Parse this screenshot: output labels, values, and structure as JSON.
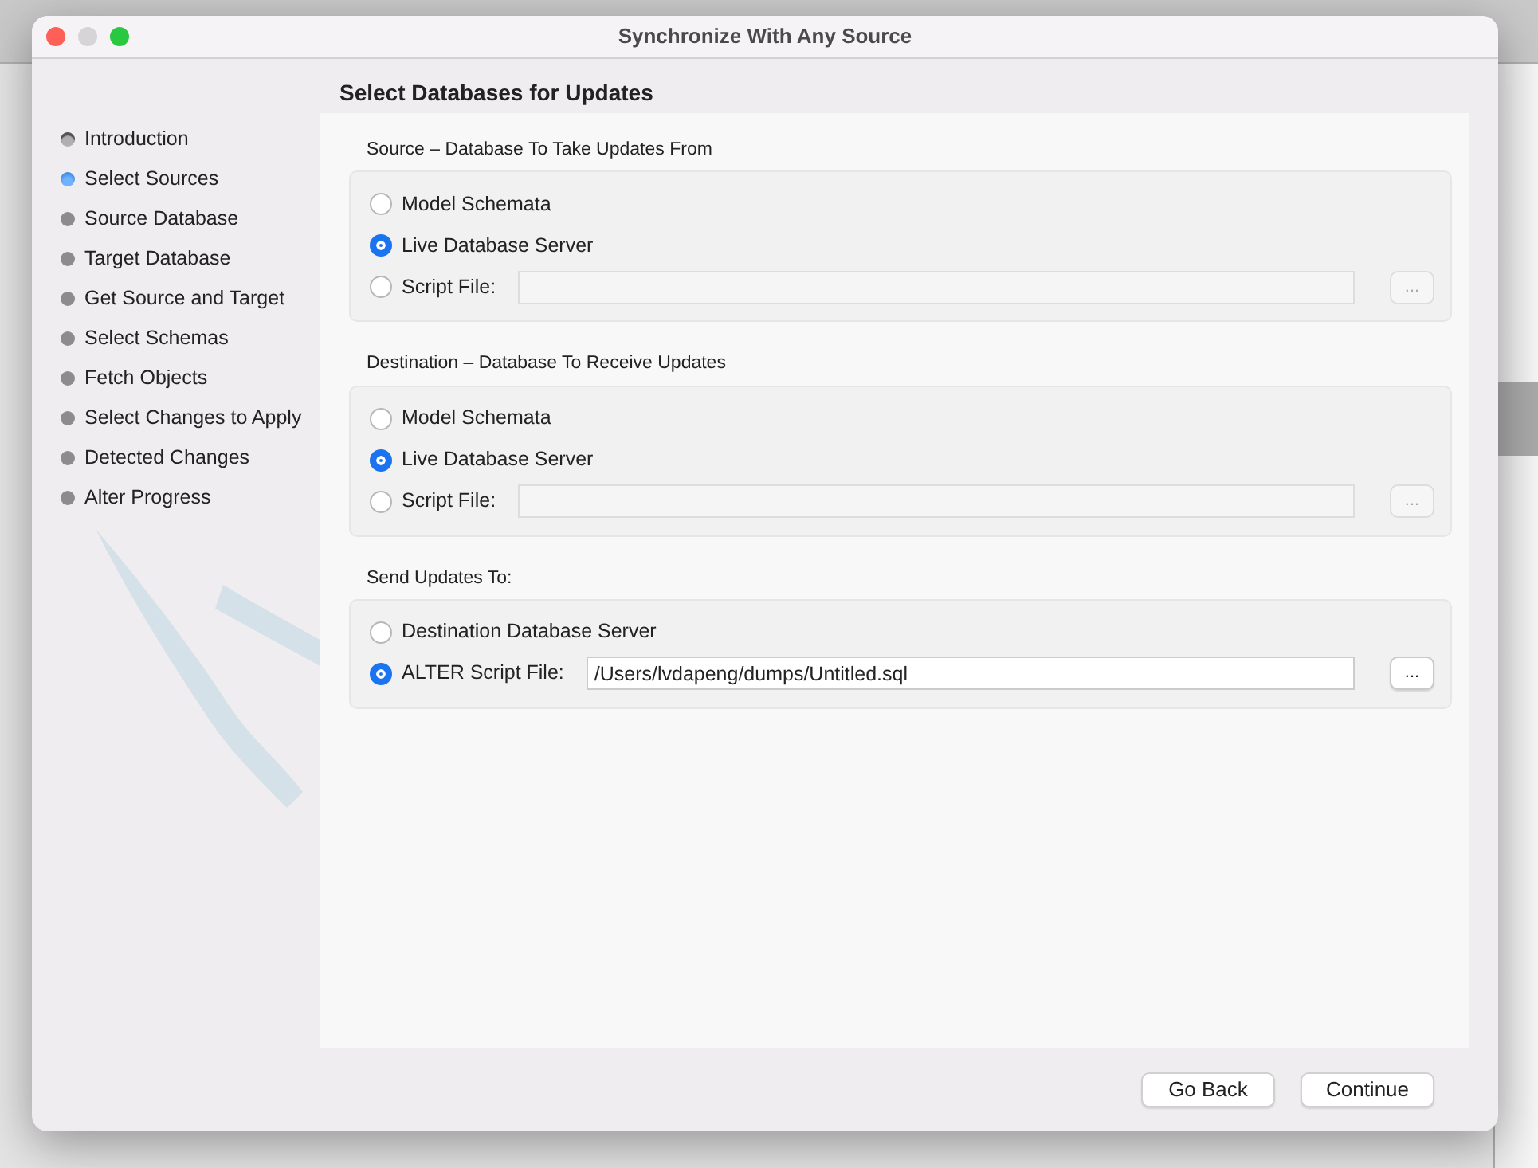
{
  "window": {
    "title": "Synchronize With Any Source"
  },
  "steps": [
    {
      "label": "Introduction",
      "completed": true,
      "selected": false
    },
    {
      "label": "Select Sources",
      "completed": false,
      "selected": true
    },
    {
      "label": "Source Database",
      "completed": false,
      "selected": false
    },
    {
      "label": "Target Database",
      "completed": false,
      "selected": false
    },
    {
      "label": "Get Source and Target",
      "completed": false,
      "selected": false
    },
    {
      "label": "Select Schemas",
      "completed": false,
      "selected": false
    },
    {
      "label": "Fetch Objects",
      "completed": false,
      "selected": false
    },
    {
      "label": "Select Changes to Apply",
      "completed": false,
      "selected": false
    },
    {
      "label": "Detected Changes",
      "completed": false,
      "selected": false
    },
    {
      "label": "Alter Progress",
      "completed": false,
      "selected": false
    }
  ],
  "heading": "Select Databases for Updates",
  "groups": [
    {
      "label": "Source – Database To Take Updates From",
      "options": [
        {
          "kind": "radio",
          "label": "Model Schemata",
          "selected": false
        },
        {
          "kind": "radio",
          "label": "Live Database Server",
          "selected": true
        },
        {
          "kind": "file",
          "label": "Script File:",
          "selected": false,
          "enabled": false,
          "browse": "..."
        }
      ]
    },
    {
      "label": "Destination – Database To Receive Updates",
      "options": [
        {
          "kind": "radio",
          "label": "Model Schemata",
          "selected": false
        },
        {
          "kind": "radio",
          "label": "Live Database Server",
          "selected": true
        },
        {
          "kind": "file",
          "label": "Script File:",
          "selected": false,
          "enabled": false,
          "browse": "..."
        }
      ]
    },
    {
      "label": "Send Updates To:",
      "options": [
        {
          "kind": "radio",
          "label": "Destination Database Server",
          "selected": false
        },
        {
          "kind": "file",
          "label": "ALTER Script File:",
          "selected": true,
          "enabled": true,
          "value": "/Users/lvdapeng/dumps/Untitled.sql",
          "browse": "..."
        }
      ]
    }
  ],
  "buttons": [
    "Go Back",
    "Continue"
  ]
}
